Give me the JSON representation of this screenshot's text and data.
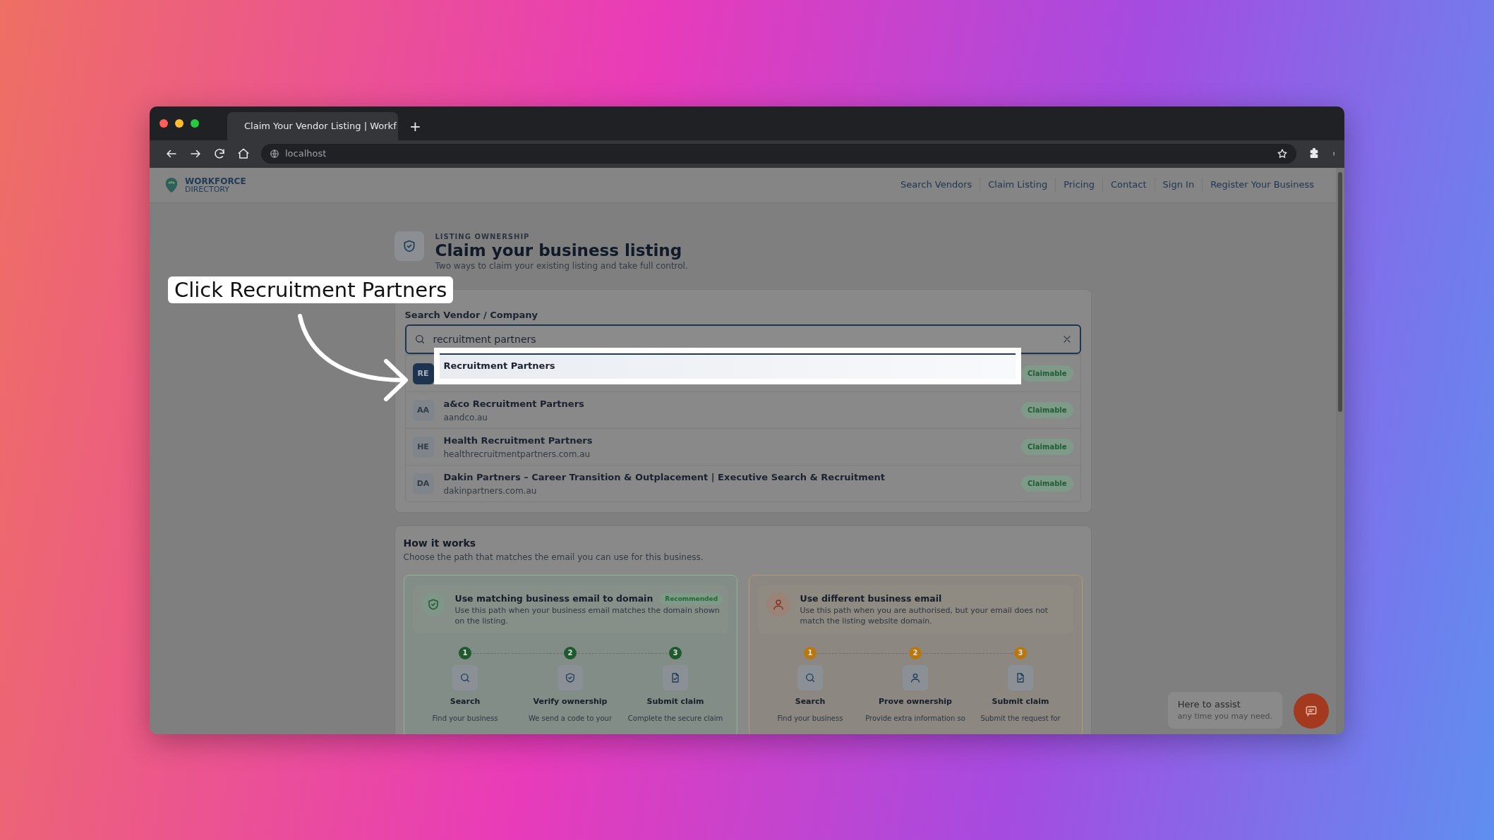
{
  "browser": {
    "tab_title": "Claim Your Vendor Listing | Workf",
    "new_tab": "+",
    "url": "localhost"
  },
  "nav": {
    "logo_line1": "WORKFORCE",
    "logo_line2": "DIRECTORY",
    "links": [
      "Search Vendors",
      "Claim Listing",
      "Pricing",
      "Contact",
      "Sign In",
      "Register Your Business"
    ]
  },
  "header": {
    "eyebrow": "LISTING OWNERSHIP",
    "title": "Claim your business listing",
    "subtitle": "Two ways to claim your existing listing and take full control."
  },
  "search": {
    "label": "Search Vendor / Company",
    "value": "recruitment partners"
  },
  "results": [
    {
      "initials": "RE",
      "name": "Recruitment Partners",
      "badge": "Claimable",
      "highlighted": true
    },
    {
      "initials": "AA",
      "name": "a&co Recruitment Partners",
      "domain": "aandco.au",
      "badge": "Claimable",
      "highlighted": false
    },
    {
      "initials": "HE",
      "name": "Health Recruitment Partners",
      "domain": "healthrecruitmentpartners.com.au",
      "badge": "Claimable",
      "highlighted": false
    },
    {
      "initials": "DA",
      "name": "Dakin Partners – Career Transition & Outplacement | Executive Search & Recruitment",
      "domain": "dakinpartners.com.au",
      "badge": "Claimable",
      "highlighted": false
    }
  ],
  "annotation": {
    "text": "Click Recruitment Partners"
  },
  "how_it_works": {
    "title": "How it works",
    "subtitle": "Choose the path that matches the email you can use for this business.",
    "paths": [
      {
        "kind": "matching",
        "title": "Use matching business email to domain",
        "badge": "Recommended",
        "description": "Use this path when your business email matches the domain shown on the listing.",
        "steps": [
          {
            "number": "1",
            "title": "Search",
            "text": "Find your business"
          },
          {
            "number": "2",
            "title": "Verify ownership",
            "text": "We send a code to your"
          },
          {
            "number": "3",
            "title": "Submit claim",
            "text": "Complete the secure claim"
          }
        ]
      },
      {
        "kind": "different",
        "title": "Use different business email",
        "description": "Use this path when you are authorised, but your email does not match the listing website domain.",
        "steps": [
          {
            "number": "1",
            "title": "Search",
            "text": "Find your business"
          },
          {
            "number": "2",
            "title": "Prove ownership",
            "text": "Provide extra information so"
          },
          {
            "number": "3",
            "title": "Submit claim",
            "text": "Submit the request for"
          }
        ]
      }
    ]
  },
  "chat": {
    "title": "Here to assist",
    "subtitle": "any time you may need."
  }
}
